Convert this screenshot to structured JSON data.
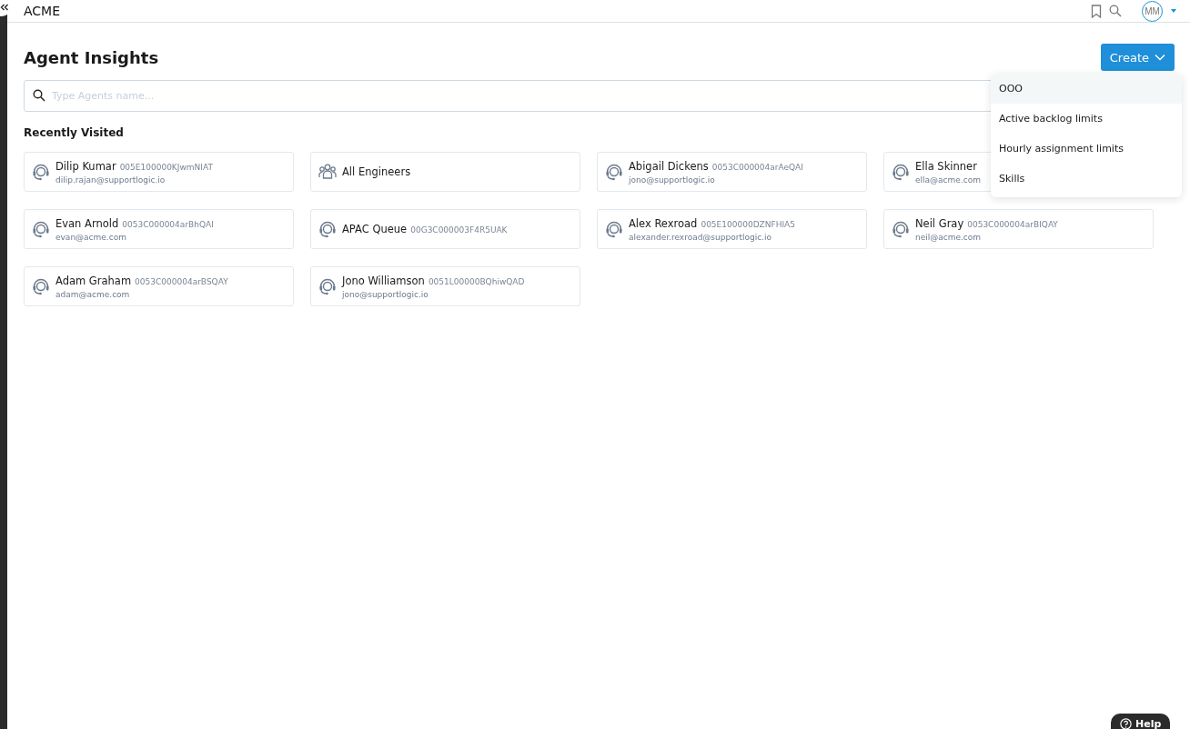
{
  "header": {
    "brand": "ACME",
    "avatar": "MM"
  },
  "page": {
    "title": "Agent Insights",
    "create_button": "Create"
  },
  "search": {
    "placeholder": "Type Agents name..."
  },
  "create_menu": [
    {
      "label": "OOO",
      "hovered": true
    },
    {
      "label": "Active backlog limits",
      "hovered": false
    },
    {
      "label": "Hourly assignment limits",
      "hovered": false
    },
    {
      "label": "Skills",
      "hovered": false
    }
  ],
  "recently_visited": {
    "title": "Recently Visited",
    "items": [
      {
        "kind": "agent",
        "name": "Dilip Kumar",
        "id": "005E100000KJwmNIAT",
        "email": "dilip.rajan@supportlogic.io"
      },
      {
        "kind": "group",
        "name": "All Engineers"
      },
      {
        "kind": "agent",
        "name": "Abigail Dickens",
        "id": "0053C000004arAeQAI",
        "email": "jono@supportlogic.io"
      },
      {
        "kind": "agent",
        "name": "Ella Skinner",
        "email": "ella@acme.com"
      },
      {
        "kind": "agent",
        "name": "Evan Arnold",
        "id": "0053C000004arBhQAI",
        "email": "evan@acme.com"
      },
      {
        "kind": "agent",
        "name": "APAC Queue",
        "id": "00G3C000003F4R5UAK"
      },
      {
        "kind": "agent",
        "name": "Alex Rexroad",
        "id": "005E100000DZNFHIA5",
        "email": "alexander.rexroad@supportlogic.io"
      },
      {
        "kind": "agent",
        "name": "Neil Gray",
        "id": "0053C000004arBIQAY",
        "email": "neil@acme.com"
      },
      {
        "kind": "agent",
        "name": "Adam Graham",
        "id": "0053C000004arBSQAY",
        "email": "adam@acme.com"
      },
      {
        "kind": "agent",
        "name": "Jono Williamson",
        "id": "0051L00000BQhiwQAD",
        "email": "jono@supportlogic.io"
      }
    ]
  },
  "help_button": "Help"
}
